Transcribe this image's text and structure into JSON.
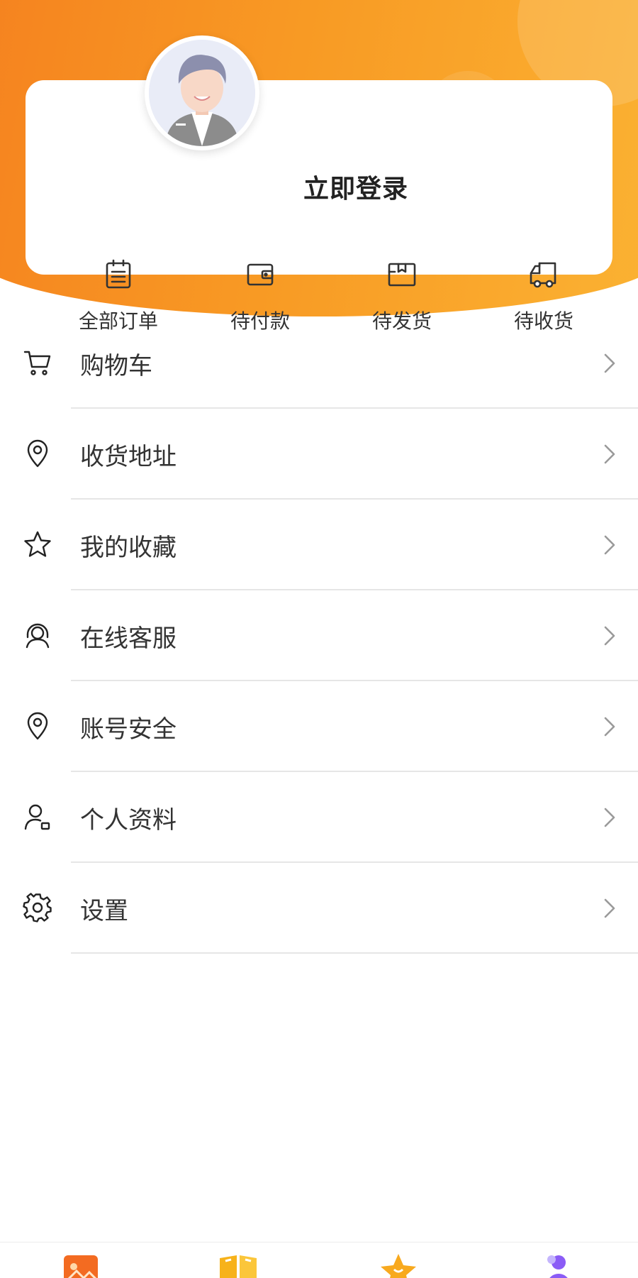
{
  "header": {
    "login_label": "立即登录"
  },
  "orders": [
    {
      "label": "全部订单",
      "icon": "clipboard-icon"
    },
    {
      "label": "待付款",
      "icon": "wallet-icon"
    },
    {
      "label": "待发货",
      "icon": "package-icon"
    },
    {
      "label": "待收货",
      "icon": "truck-icon"
    }
  ],
  "menu": [
    {
      "label": "购物车",
      "icon": "cart-icon"
    },
    {
      "label": "收货地址",
      "icon": "location-pin-icon"
    },
    {
      "label": "我的收藏",
      "icon": "star-icon"
    },
    {
      "label": "在线客服",
      "icon": "headset-icon"
    },
    {
      "label": "账号安全",
      "icon": "location-pin-icon"
    },
    {
      "label": "个人资料",
      "icon": "user-profile-icon"
    },
    {
      "label": "设置",
      "icon": "gear-icon"
    }
  ],
  "tabbar": [
    {
      "icon": "gallery-icon",
      "color": "#f36b21"
    },
    {
      "icon": "book-icon",
      "color": "#f7b21a"
    },
    {
      "icon": "star-face-icon",
      "color": "#f8a91e"
    },
    {
      "icon": "person-icon",
      "color": "#8b5cf6"
    }
  ],
  "colors": {
    "accent_orange": "#f5821f",
    "accent_yellow": "#fbb333"
  }
}
